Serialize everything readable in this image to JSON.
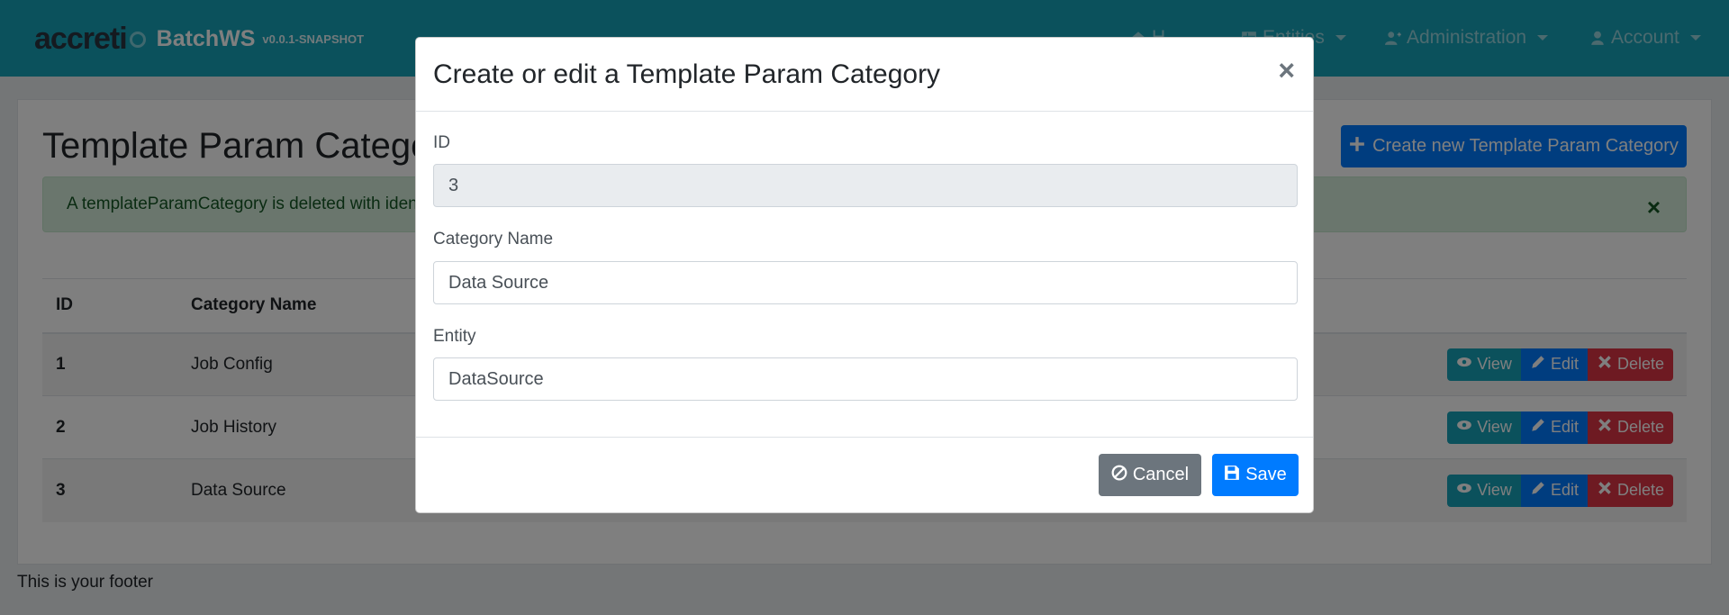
{
  "navbar": {
    "logo_text": "accreti",
    "app_name": "BatchWS",
    "version": "v0.0.1-SNAPSHOT",
    "home_label": "H",
    "entities_label": "Entities",
    "administration_label": "Administration",
    "account_label": "Account",
    "color": "#17a2b8"
  },
  "page": {
    "title": "Template Param Categor",
    "create_button_label": "Create new Template Param Category",
    "alert_text": "A templateParamCategory is deleted with iden",
    "alert_close": "×",
    "table": {
      "headers": [
        "ID",
        "Category Name"
      ],
      "rows": [
        {
          "id": "1",
          "name": "Job Config"
        },
        {
          "id": "2",
          "name": "Job History"
        },
        {
          "id": "3",
          "name": "Data Source"
        }
      ],
      "view_label": "View",
      "edit_label": "Edit",
      "delete_label": "Delete"
    },
    "footer": "This is your footer"
  },
  "modal": {
    "title": "Create or edit a Template Param Category",
    "close": "×",
    "id_label": "ID",
    "id_value": "3",
    "name_label": "Category Name",
    "name_value": "Data Source",
    "entity_label": "Entity",
    "entity_value": "DataSource",
    "cancel_label": "Cancel",
    "save_label": "Save"
  },
  "icons": {
    "create": "plus-icon",
    "view": "eye-icon",
    "edit": "pencil-icon",
    "delete": "times-icon",
    "cancel": "ban-icon",
    "save": "save-icon"
  }
}
